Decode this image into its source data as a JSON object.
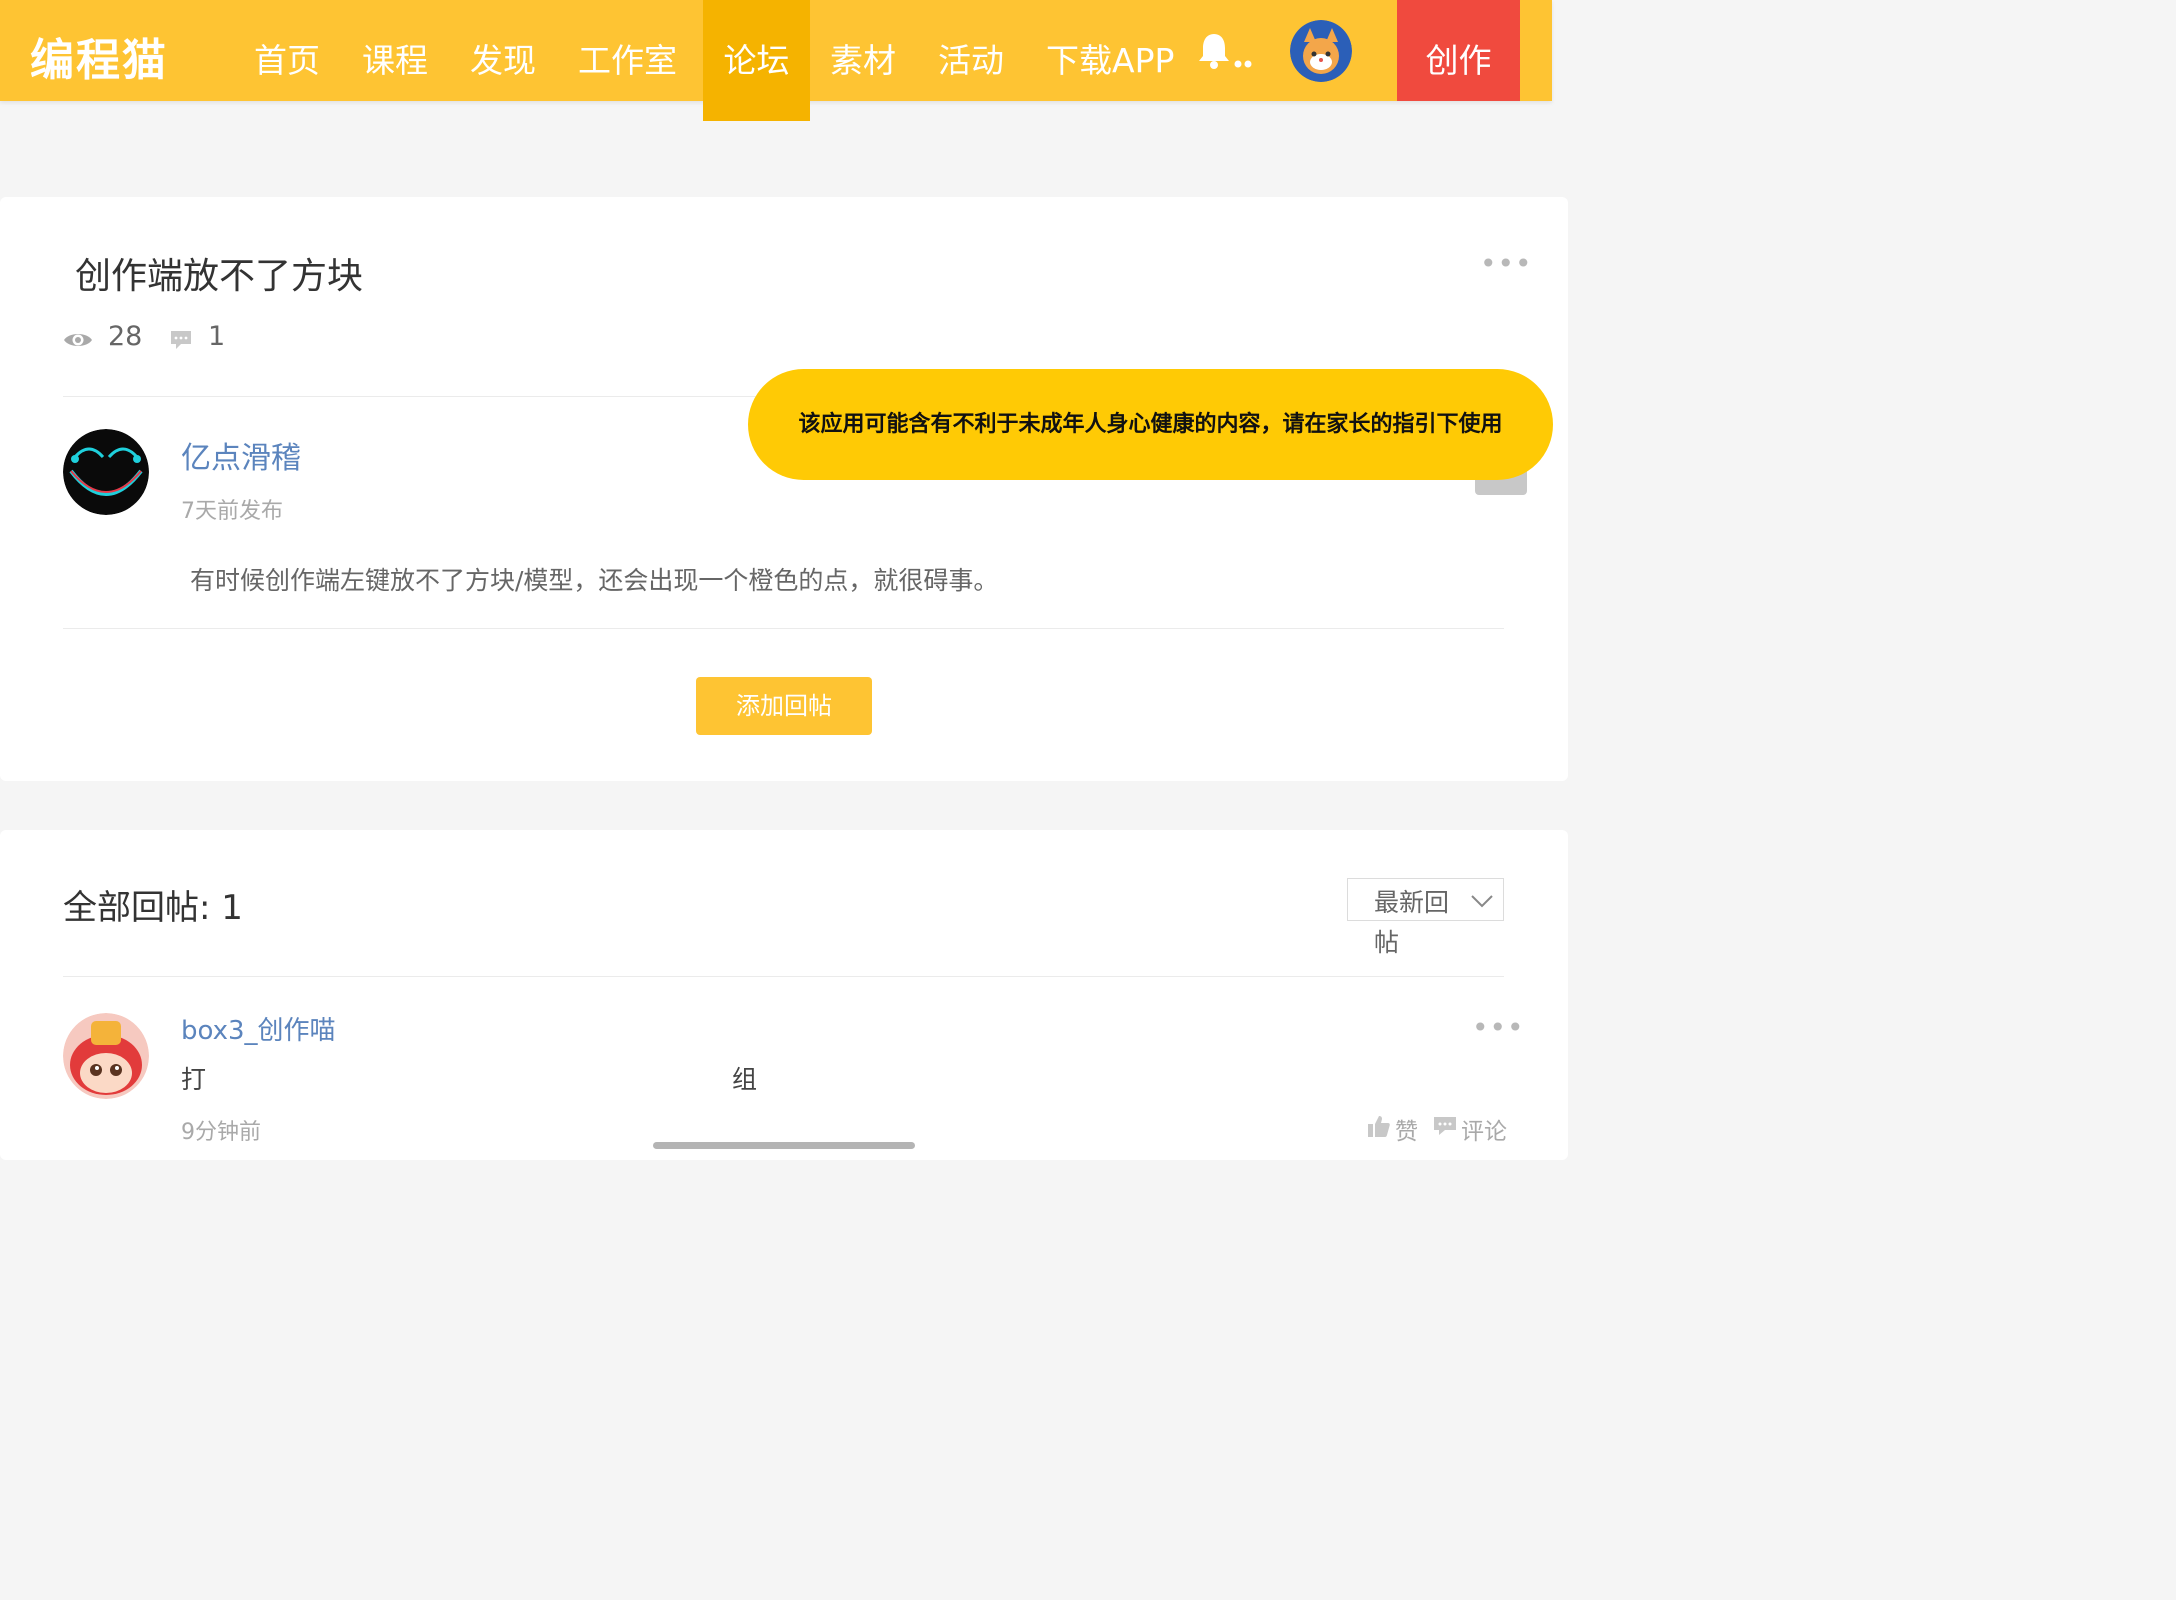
{
  "nav": {
    "logo": "编程猫",
    "items": [
      "首页",
      "课程",
      "发现",
      "工作室",
      "论坛",
      "素材",
      "活动",
      "下载APP"
    ],
    "active_index": 4,
    "create_label": "创作",
    "colors": {
      "bar": "#fec433",
      "active": "#f5b300",
      "create": "#f04a3e"
    }
  },
  "post": {
    "title": "创作端放不了方块",
    "views": "28",
    "comments": "1",
    "author": "亿点滑稽",
    "time": "7天前发布",
    "body": "有时候创作端左键放不了方块/模型，还会出现一个橙色的点，就很碍事。",
    "reply_button": "添加回帖"
  },
  "toast": {
    "text": "该应用可能含有不利于未成年人身心健康的内容，请在家长的指引下使用"
  },
  "replies": {
    "title": "全部回帖: 1",
    "sort_label": "最新回帖",
    "items": [
      {
        "author": "box3_创作喵",
        "text_left": "打",
        "text_right": "组",
        "time": "9分钟前",
        "like": "赞",
        "comment": "评论"
      }
    ]
  }
}
